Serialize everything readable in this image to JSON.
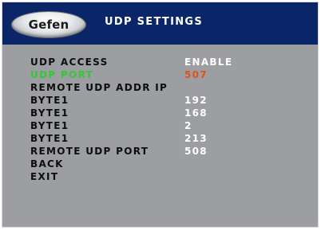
{
  "header": {
    "logo_text": "Gefen",
    "title": "UDP SETTINGS"
  },
  "menu": {
    "items": [
      {
        "label": "UDP ACCESS",
        "value": "ENABLE",
        "selected": false
      },
      {
        "label": "UDP PORT",
        "value": "507",
        "selected": true
      },
      {
        "label": "REMOTE UDP ADDR IP",
        "value": "",
        "selected": false
      },
      {
        "label": "BYTE1",
        "value": "192",
        "selected": false
      },
      {
        "label": "BYTE1",
        "value": "168",
        "selected": false
      },
      {
        "label": "BYTE1",
        "value": "2",
        "selected": false
      },
      {
        "label": "BYTE1",
        "value": "213",
        "selected": false
      },
      {
        "label": "REMOTE UDP PORT",
        "value": "508",
        "selected": false
      },
      {
        "label": "BACK",
        "value": "",
        "selected": false
      },
      {
        "label": "EXIT",
        "value": "",
        "selected": false
      }
    ]
  },
  "colors": {
    "header_bg": "#0a2669",
    "screen_bg": "#9c9ea1",
    "selected_label": "#32c832",
    "selected_value": "#e0501c",
    "value_text": "#ffffff",
    "label_text": "#0d0d0d"
  }
}
